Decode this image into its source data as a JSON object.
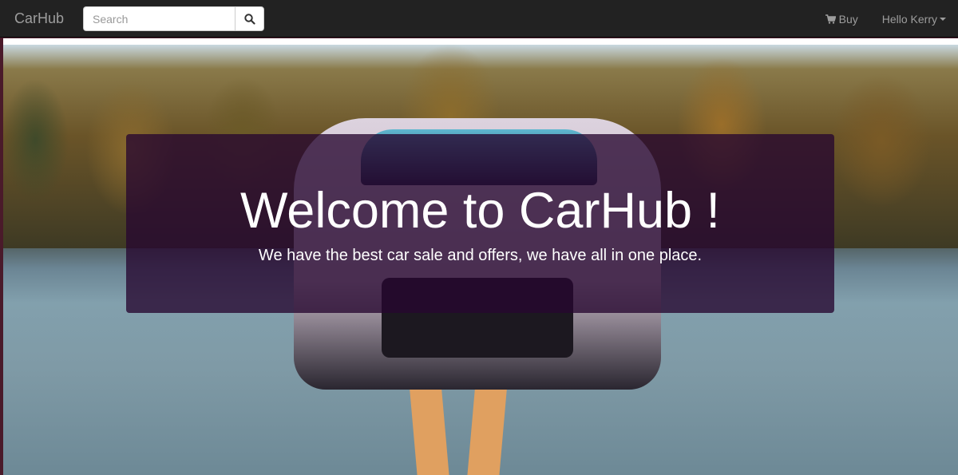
{
  "navbar": {
    "brand": "CarHub",
    "search": {
      "placeholder": "Search",
      "button_icon": "search-icon"
    },
    "buy": {
      "label": "Buy",
      "icon": "shopping-cart-icon"
    },
    "user": {
      "label": "Hello Kerry",
      "icon": "caret-down-icon"
    }
  },
  "hero": {
    "title": "Welcome to CarHub !",
    "subtitle": "We have the best car sale and offers, we have all in one place."
  },
  "colors": {
    "navbar_bg": "#222222",
    "nav_text": "#9d9d9d",
    "overlay_bg": "#260630"
  }
}
